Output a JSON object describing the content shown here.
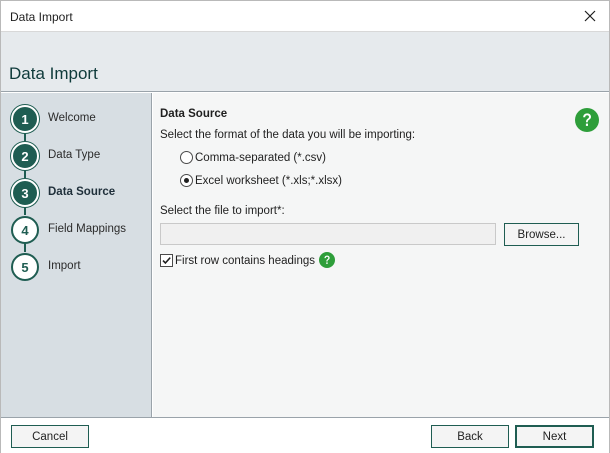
{
  "window": {
    "title": "Data Import"
  },
  "header": {
    "heading": "Data Import"
  },
  "steps": [
    {
      "number": "1",
      "label": "Welcome",
      "state": "done"
    },
    {
      "number": "2",
      "label": "Data Type",
      "state": "done"
    },
    {
      "number": "3",
      "label": "Data Source",
      "state": "active"
    },
    {
      "number": "4",
      "label": "Field Mappings",
      "state": "todo"
    },
    {
      "number": "5",
      "label": "Import",
      "state": "todo"
    }
  ],
  "content": {
    "section_title": "Data Source",
    "format_prompt": "Select the format of the data you will be importing:",
    "format_options": [
      {
        "label": "Comma-separated (*.csv)",
        "selected": false
      },
      {
        "label": "Excel worksheet (*.xls;*.xlsx)",
        "selected": true
      }
    ],
    "file_label": "Select the file to import*:",
    "file_value": "",
    "browse_label": "Browse...",
    "headings_checkbox": {
      "label": "First row contains headings",
      "checked": true
    }
  },
  "footer": {
    "cancel_label": "Cancel",
    "back_label": "Back",
    "next_label": "Next"
  },
  "colors": {
    "accent": "#1f5d52",
    "help_green": "#2e9e3a",
    "sidebar_bg": "#d7dee3",
    "header_bg": "#e6eaed"
  }
}
